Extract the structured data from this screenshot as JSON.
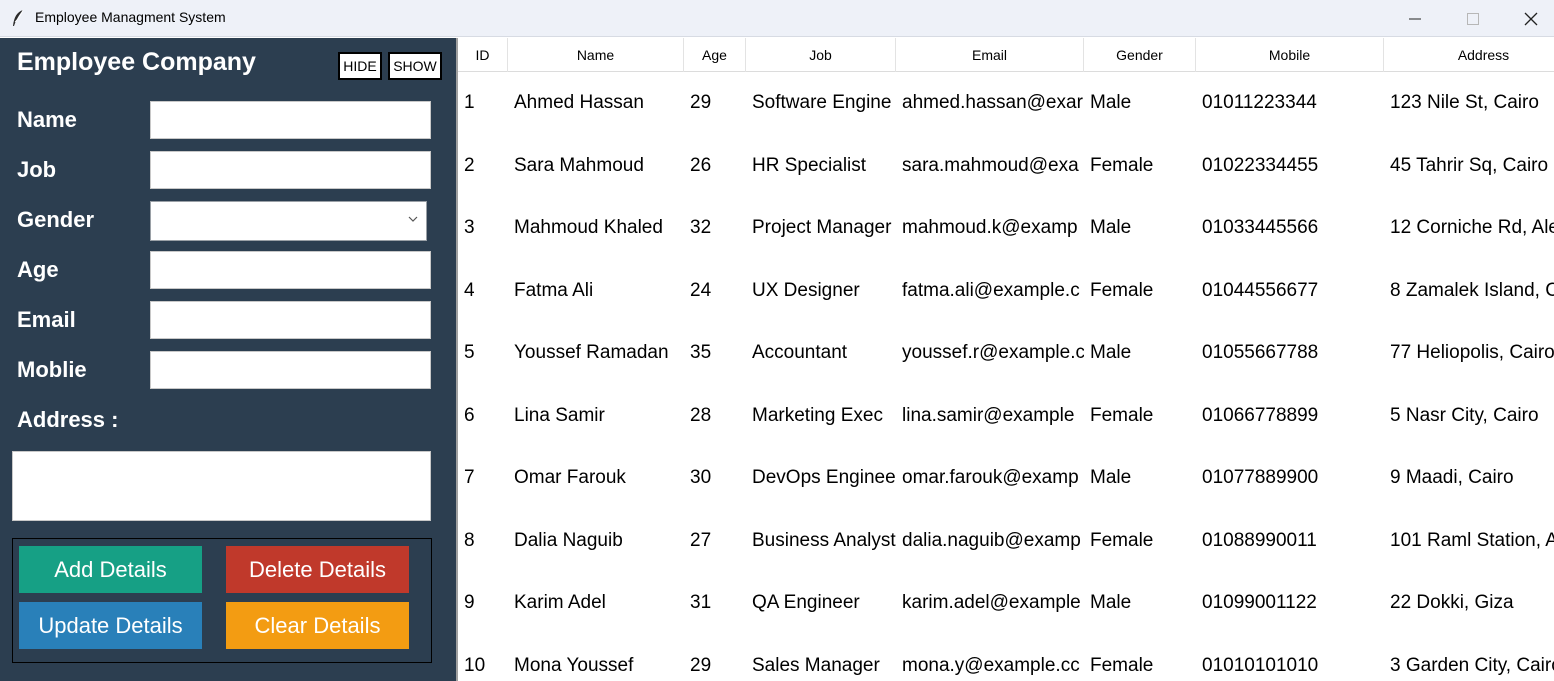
{
  "window": {
    "title": "Employee Managment System",
    "icon": "feather-icon"
  },
  "form": {
    "company": "Employee Company",
    "hide_label": "HIDE",
    "show_label": "SHOW",
    "labels": {
      "name": "Name",
      "job": "Job",
      "gender": "Gender",
      "age": "Age",
      "email": "Email",
      "mobile": "Moblie",
      "address": "Address :"
    },
    "values": {
      "name": "",
      "job": "",
      "gender": "",
      "age": "",
      "email": "",
      "mobile": "",
      "address": ""
    },
    "buttons": {
      "add": "Add Details",
      "delete": "Delete Details",
      "update": "Update Details",
      "clear": "Clear Details"
    },
    "colors": {
      "panel": "#2c3e50",
      "add": "#16a085",
      "delete": "#c0392b",
      "update": "#2980b9",
      "clear": "#f39c12"
    }
  },
  "table": {
    "columns": [
      "ID",
      "Name",
      "Age",
      "Job",
      "Email",
      "Gender",
      "Mobile",
      "Address"
    ],
    "rows": [
      [
        "1",
        "Ahmed Hassan",
        "29",
        "Software Engine",
        "ahmed.hassan@exar",
        "Male",
        "01011223344",
        "123 Nile St, Cairo"
      ],
      [
        "2",
        "Sara Mahmoud",
        "26",
        "HR Specialist",
        "sara.mahmoud@exa",
        "Female",
        "01022334455",
        "45 Tahrir Sq, Cairo"
      ],
      [
        "3",
        "Mahmoud Khaled",
        "32",
        "Project Manager",
        "mahmoud.k@examp",
        "Male",
        "01033445566",
        "12 Corniche Rd, Ale"
      ],
      [
        "4",
        "Fatma Ali",
        "24",
        "UX Designer",
        "fatma.ali@example.c",
        "Female",
        "01044556677",
        "8 Zamalek Island, C"
      ],
      [
        "5",
        "Youssef Ramadan",
        "35",
        "Accountant",
        "youssef.r@example.c",
        "Male",
        "01055667788",
        "77 Heliopolis, Cairo"
      ],
      [
        "6",
        "Lina Samir",
        "28",
        "Marketing Exec",
        "lina.samir@example",
        "Female",
        "01066778899",
        "5 Nasr City, Cairo"
      ],
      [
        "7",
        "Omar Farouk",
        "30",
        "DevOps Enginee",
        "omar.farouk@examp",
        "Male",
        "01077889900",
        "9 Maadi, Cairo"
      ],
      [
        "8",
        "Dalia Naguib",
        "27",
        "Business Analyst",
        "dalia.naguib@examp",
        "Female",
        "01088990011",
        "101 Raml Station, A"
      ],
      [
        "9",
        "Karim Adel",
        "31",
        "QA Engineer",
        "karim.adel@example",
        "Male",
        "01099001122",
        "22 Dokki, Giza"
      ],
      [
        "10",
        "Mona Youssef",
        "29",
        "Sales Manager",
        "mona.y@example.cc",
        "Female",
        "01010101010",
        "3 Garden City, Cairo"
      ]
    ]
  }
}
